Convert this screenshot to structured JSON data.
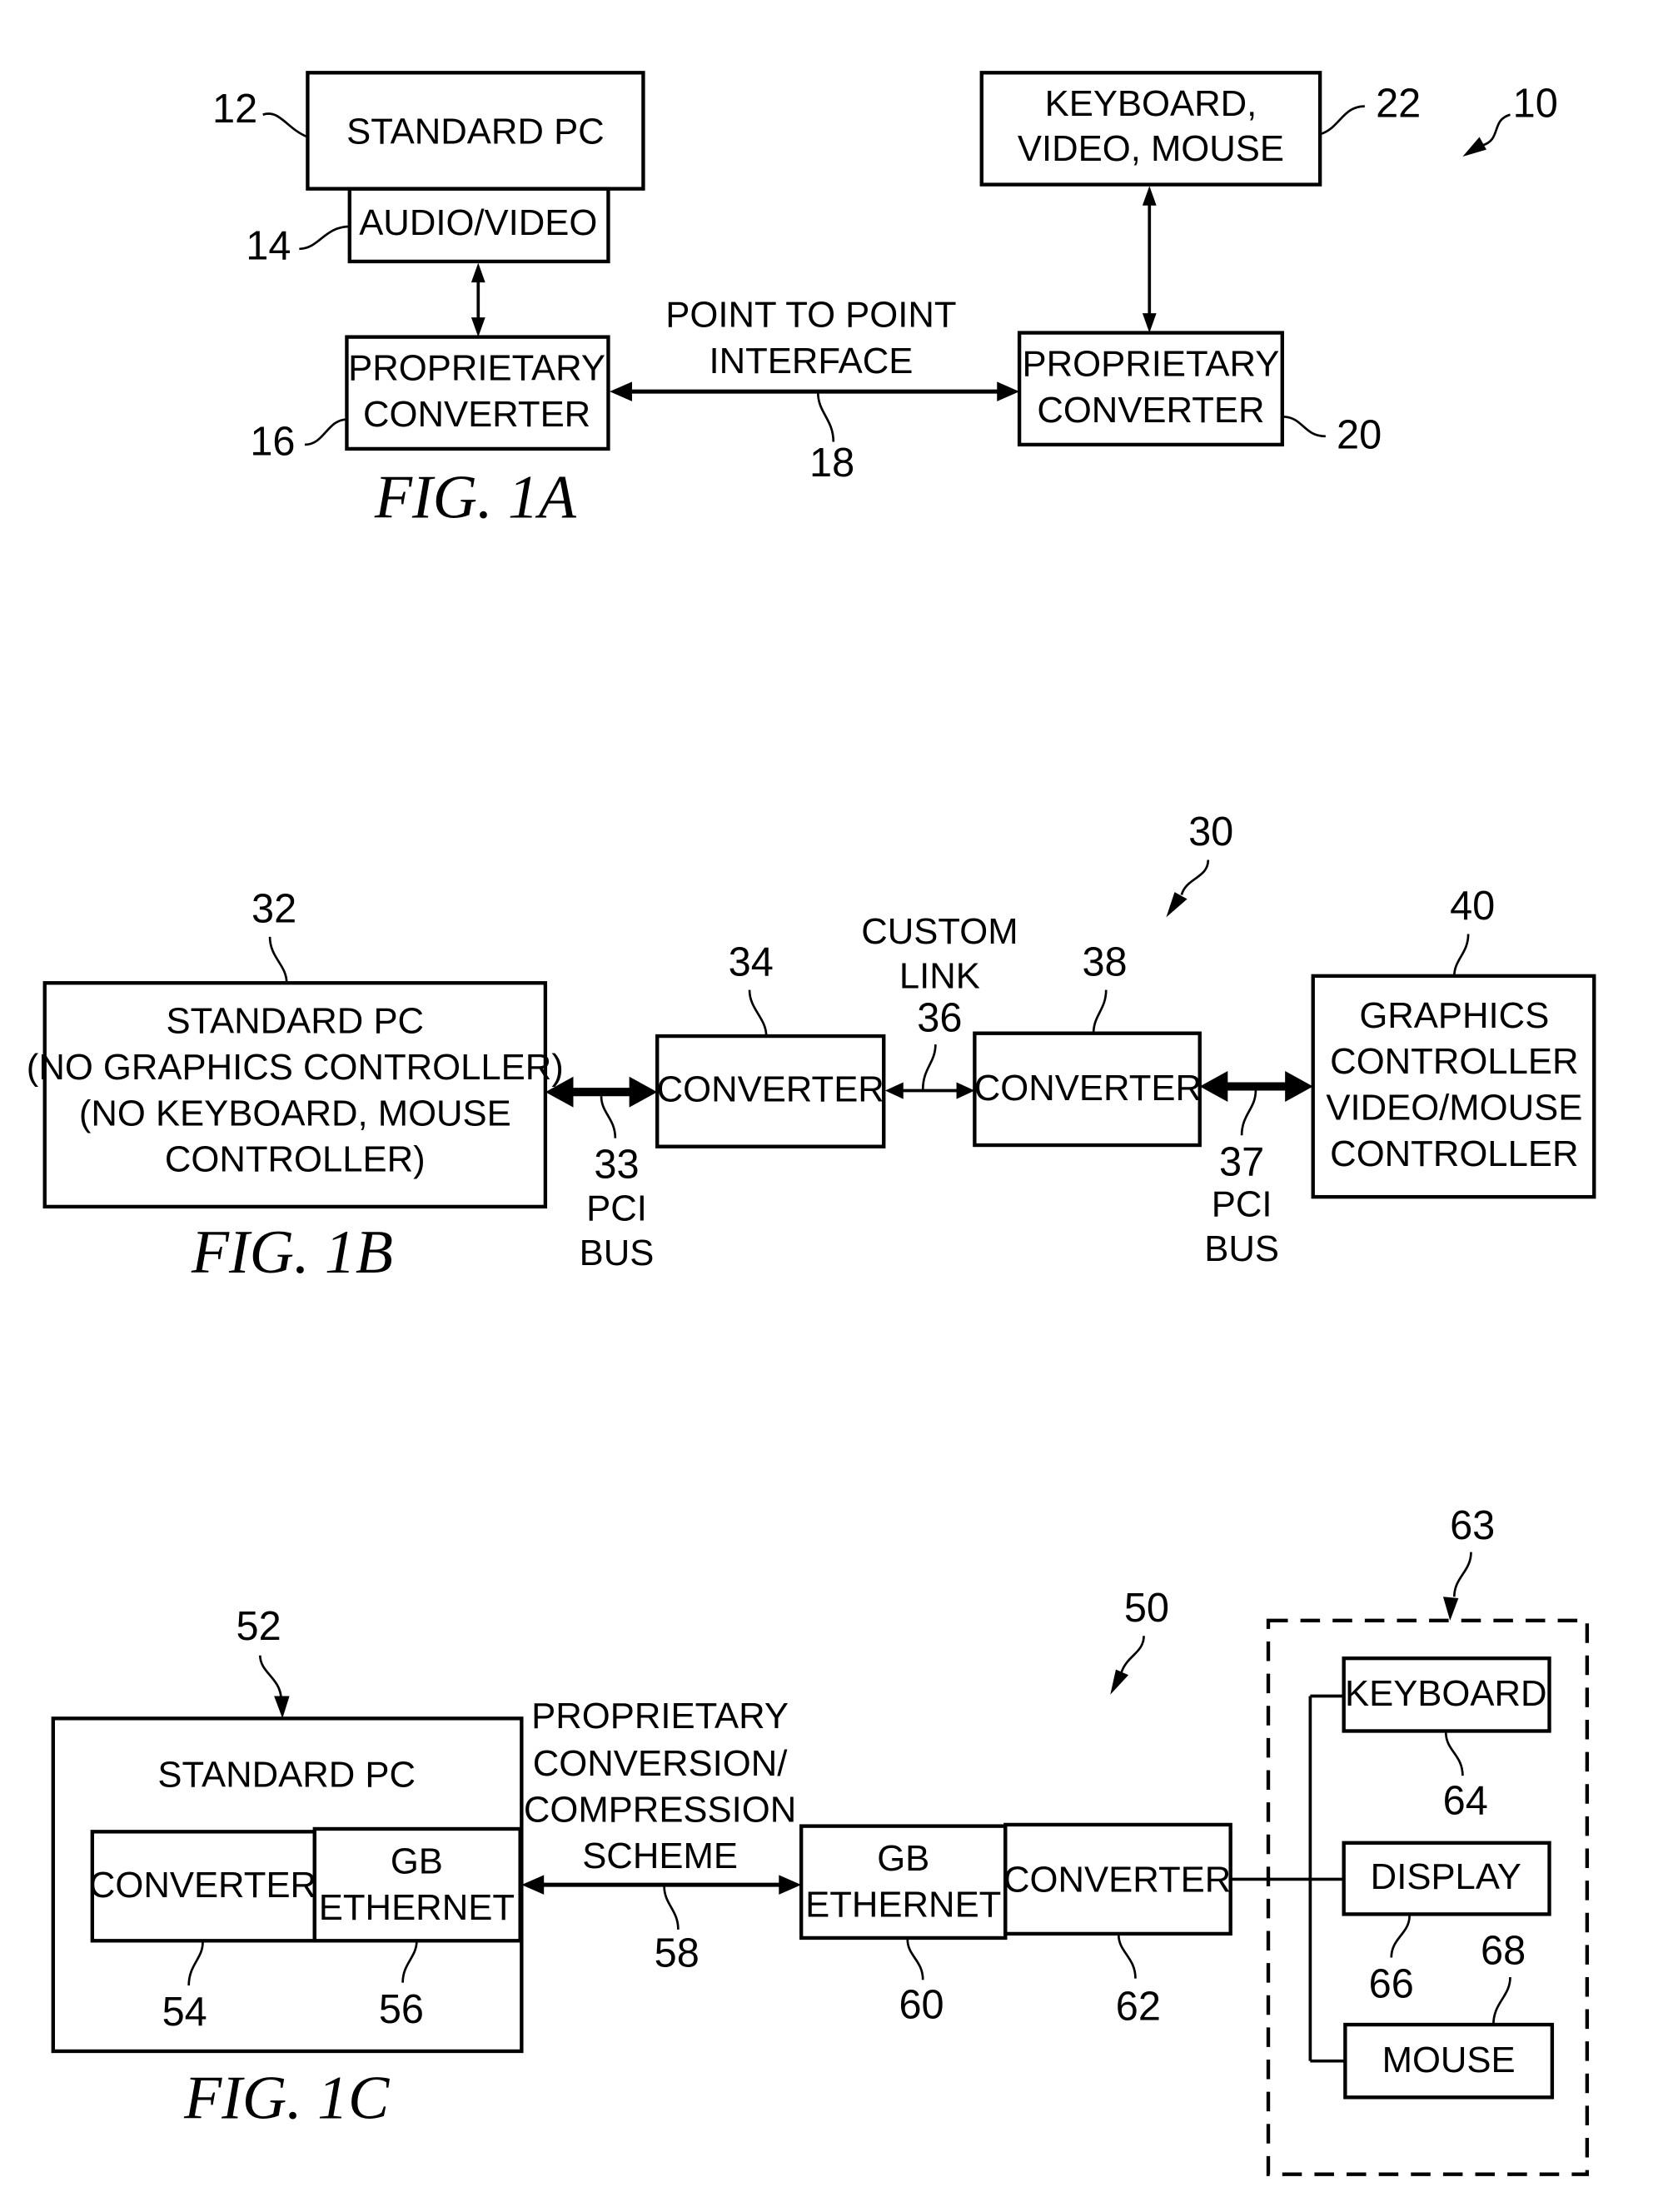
{
  "figures": {
    "fig1a": {
      "caption": "FIG. 1A",
      "system_ref": "10",
      "standard_pc": {
        "label": "STANDARD PC",
        "ref": "12"
      },
      "audio_video": {
        "label": "AUDIO/VIDEO",
        "ref": "14"
      },
      "converter_left": {
        "line1": "PROPRIETARY",
        "line2": "CONVERTER",
        "ref": "16"
      },
      "link": {
        "line1": "POINT TO POINT",
        "line2": "INTERFACE",
        "ref": "18"
      },
      "converter_right": {
        "line1": "PROPRIETARY",
        "line2": "CONVERTER",
        "ref": "20"
      },
      "kvm": {
        "line1": "KEYBOARD,",
        "line2": "VIDEO, MOUSE",
        "ref": "22"
      }
    },
    "fig1b": {
      "caption": "FIG. 1B",
      "system_ref": "30",
      "standard_pc": {
        "line1": "STANDARD PC",
        "line2": "(NO GRAPHICS CONTROLLER)",
        "line3": "(NO KEYBOARD, MOUSE",
        "line4": "CONTROLLER)",
        "ref": "32"
      },
      "bus_left": {
        "ref": "33",
        "line1": "PCI",
        "line2": "BUS"
      },
      "converter_left": {
        "label": "CONVERTER",
        "ref": "34"
      },
      "link": {
        "line1": "CUSTOM",
        "line2": "LINK",
        "ref": "36"
      },
      "bus_right": {
        "ref": "37",
        "line1": "PCI",
        "line2": "BUS"
      },
      "converter_right": {
        "label": "CONVERTER",
        "ref": "38"
      },
      "graphics": {
        "line1": "GRAPHICS",
        "line2": "CONTROLLER",
        "line3": "VIDEO/MOUSE",
        "line4": "CONTROLLER",
        "ref": "40"
      }
    },
    "fig1c": {
      "caption": "FIG. 1C",
      "system_ref": "50",
      "standard_pc": {
        "label": "STANDARD PC",
        "ref": "52"
      },
      "pc_converter": {
        "label": "CONVERTER",
        "ref": "54"
      },
      "pc_ethernet": {
        "line1": "GB",
        "line2": "ETHERNET",
        "ref": "56"
      },
      "link": {
        "line1": "PROPRIETARY",
        "line2": "CONVERSION/",
        "line3": "COMPRESSION",
        "line4": "SCHEME",
        "ref": "58"
      },
      "remote_ethernet": {
        "line1": "GB",
        "line2": "ETHERNET",
        "ref": "60"
      },
      "remote_converter": {
        "label": "CONVERTER",
        "ref": "62"
      },
      "peripherals_group": {
        "ref": "63"
      },
      "keyboard": {
        "label": "KEYBOARD",
        "ref": "64"
      },
      "display": {
        "label": "DISPLAY",
        "ref": "66"
      },
      "mouse": {
        "label": "MOUSE",
        "ref": "68"
      }
    }
  }
}
